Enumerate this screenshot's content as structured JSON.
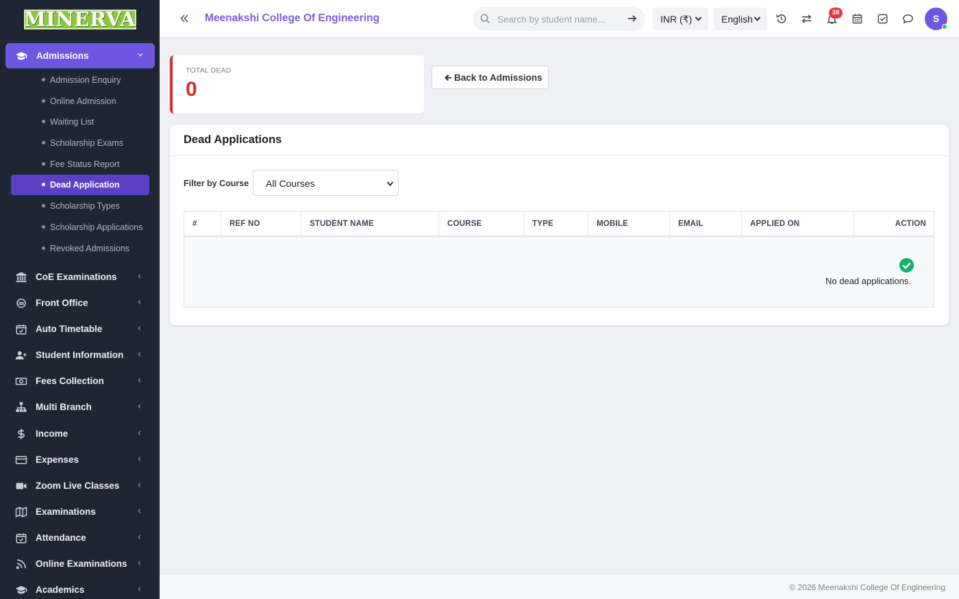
{
  "sidebar": {
    "logo_text": "MINERVA",
    "active_section": {
      "label": "Admissions",
      "icon": "graduation-cap-icon"
    },
    "submenu": [
      {
        "label": "Admission Enquiry"
      },
      {
        "label": "Online Admission"
      },
      {
        "label": "Waiting List"
      },
      {
        "label": "Scholarship Exams"
      },
      {
        "label": "Fee Status Report"
      },
      {
        "label": "Dead Application",
        "active": true
      },
      {
        "label": "Scholarship Types"
      },
      {
        "label": "Scholarship Applications"
      },
      {
        "label": "Revoked Admissions"
      }
    ],
    "items": [
      {
        "label": "CoE Examinations",
        "icon": "bank-icon"
      },
      {
        "label": "Front Office",
        "icon": "concierge-icon"
      },
      {
        "label": "Auto Timetable",
        "icon": "calendar-check-icon"
      },
      {
        "label": "Student Information",
        "icon": "user-add-icon"
      },
      {
        "label": "Fees Collection",
        "icon": "money-icon"
      },
      {
        "label": "Multi Branch",
        "icon": "sitemap-icon"
      },
      {
        "label": "Income",
        "icon": "dollar-icon"
      },
      {
        "label": "Expenses",
        "icon": "credit-card-icon"
      },
      {
        "label": "Zoom Live Classes",
        "icon": "video-icon"
      },
      {
        "label": "Examinations",
        "icon": "map-icon"
      },
      {
        "label": "Attendance",
        "icon": "calendar-check-icon"
      },
      {
        "label": "Online Examinations",
        "icon": "rss-icon"
      },
      {
        "label": "Academics",
        "icon": "graduation-cap-icon"
      }
    ]
  },
  "topbar": {
    "college_name": "Meenakshi College Of Engineering",
    "search_placeholder": "Search by student name...",
    "currency": "INR (₹)",
    "language": "English",
    "notification_count": "38",
    "avatar_initial": "S"
  },
  "stat": {
    "caption": "TOTAL DEAD",
    "value": "0",
    "accent": "#d32f2f"
  },
  "back_button": "Back to Admissions",
  "panel": {
    "title": "Dead Applications",
    "filter_label": "Filter by Course",
    "filter_value": "All Courses",
    "columns": [
      "#",
      "REF NO",
      "STUDENT NAME",
      "COURSE",
      "TYPE",
      "MOBILE",
      "EMAIL",
      "APPLIED ON",
      "ACTION"
    ],
    "empty_message": "No dead applications."
  },
  "footer": "© 2026 Meenakshi College Of Engineering",
  "colors": {
    "accent": "#6f56e0",
    "sidebar": "#1e2533",
    "danger": "#d32f2f",
    "success": "#16b26a"
  }
}
